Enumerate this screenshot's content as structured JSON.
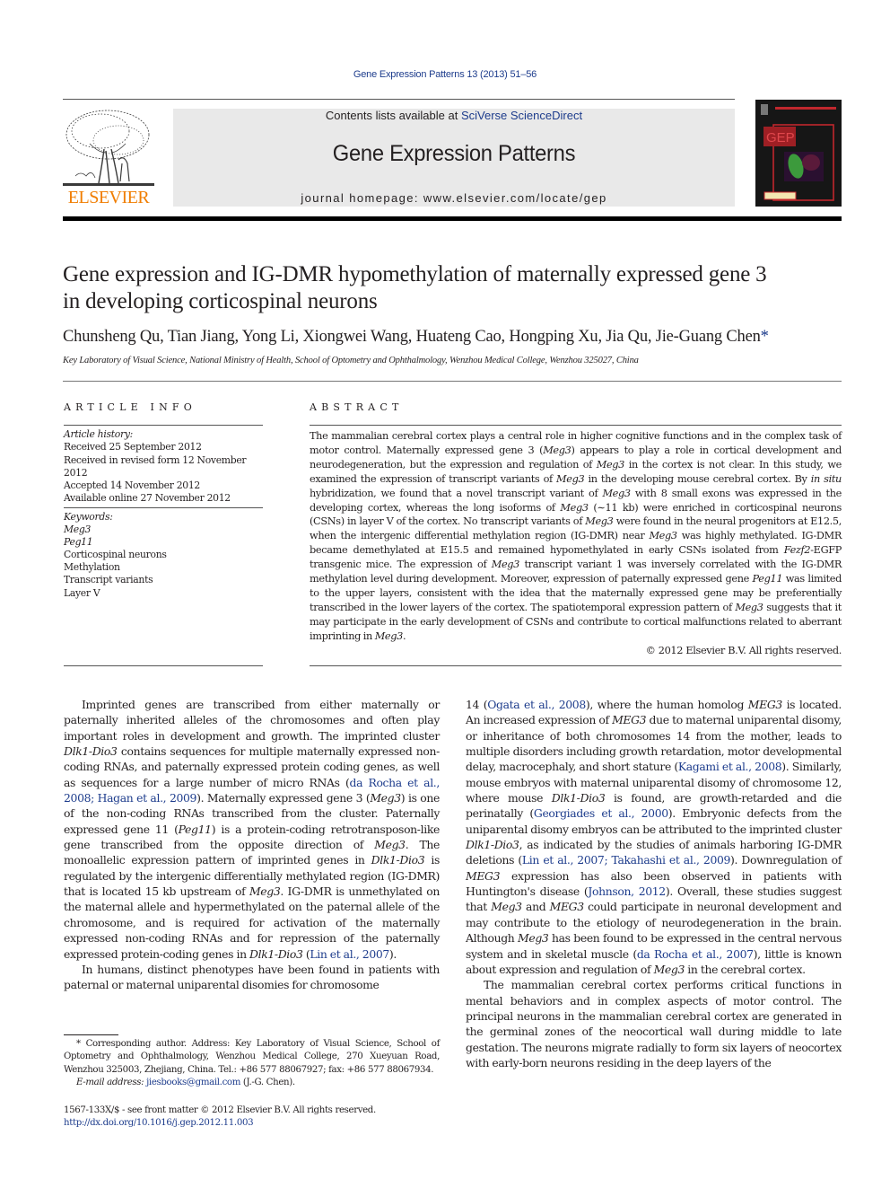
{
  "citation": "Gene Expression Patterns 13 (2013) 51–56",
  "header": {
    "publisher_logo_label": "ELSEVIER",
    "contents_prefix": "Contents lists available at ",
    "contents_link": "SciVerse ScienceDirect",
    "journal_title": "Gene Expression Patterns",
    "homepage_prefix": "journal homepage: ",
    "homepage_url": "www.elsevier.com/locate/gep",
    "cover_label": "GEP",
    "brand_colors": {
      "elsevier_orange": "#f07d00",
      "link_blue": "#1d3c8c",
      "cover_red": "#c1272d"
    }
  },
  "article": {
    "title_line1": "Gene expression and IG-DMR hypomethylation of maternally expressed gene 3",
    "title_line2": "in developing corticospinal neurons",
    "authors": "Chunsheng Qu, Tian Jiang, Yong Li, Xiongwei Wang, Huateng Cao, Hongping Xu, Jia Qu, Jie-Guang Chen",
    "corresponding_mark": "*",
    "affiliation": "Key Laboratory of Visual Science, National Ministry of Health, School of Optometry and Ophthalmology, Wenzhou Medical College, Wenzhou 325027, China"
  },
  "article_info": {
    "heading": "ARTICLE INFO",
    "history_label": "Article history:",
    "history": [
      "Received 25 September 2012",
      "Received in revised form 12 November 2012",
      "Accepted 14 November 2012",
      "Available online 27 November 2012"
    ],
    "keywords_label": "Keywords:",
    "keywords": [
      {
        "text": "Meg3",
        "italic": true
      },
      {
        "text": "Peg11",
        "italic": true
      },
      {
        "text": "Corticospinal neurons",
        "italic": false
      },
      {
        "text": "Methylation",
        "italic": false
      },
      {
        "text": "Transcript variants",
        "italic": false
      },
      {
        "text": "Layer V",
        "italic": false
      }
    ]
  },
  "abstract": {
    "heading": "ABSTRACT",
    "segments": [
      {
        "t": "The mammalian cerebral cortex plays a central role in higher cognitive functions and in the complex task of motor control. Maternally expressed gene 3 ("
      },
      {
        "t": "Meg3",
        "i": true
      },
      {
        "t": ") appears to play a role in cortical development and neurodegeneration, but the expression and regulation of "
      },
      {
        "t": "Meg3",
        "i": true
      },
      {
        "t": " in the cortex is not clear. In this study, we examined the expression of transcript variants of "
      },
      {
        "t": "Meg3",
        "i": true
      },
      {
        "t": " in the developing mouse cerebral cortex. By "
      },
      {
        "t": "in situ",
        "i": true
      },
      {
        "t": " hybridization, we found that a novel transcript variant of "
      },
      {
        "t": "Meg3",
        "i": true
      },
      {
        "t": " with 8 small exons was expressed in the developing cortex, whereas the long isoforms of "
      },
      {
        "t": "Meg3",
        "i": true
      },
      {
        "t": " (∼11 kb) were enriched in corticospinal neurons (CSNs) in layer V of the cortex. No transcript variants of "
      },
      {
        "t": "Meg3",
        "i": true
      },
      {
        "t": " were found in the neural progenitors at E12.5, when the intergenic differential methylation region (IG-DMR) near "
      },
      {
        "t": "Meg3",
        "i": true
      },
      {
        "t": " was highly methylated. IG-DMR became demethylated at E15.5 and remained hypomethylated in early CSNs isolated from "
      },
      {
        "t": "Fezf2",
        "i": true
      },
      {
        "t": "-EGFP transgenic mice. The expression of "
      },
      {
        "t": "Meg3",
        "i": true
      },
      {
        "t": " transcript variant 1 was inversely correlated with the IG-DMR methylation level during development. Moreover, expression of paternally expressed gene "
      },
      {
        "t": "Peg11",
        "i": true
      },
      {
        "t": " was limited to the upper layers, consistent with the idea that the maternally expressed gene may be pref­erentially transcribed in the lower layers of the cortex. The spatiotemporal expression pattern of "
      },
      {
        "t": "Meg3",
        "i": true
      },
      {
        "t": " suggests that it may participate in the early development of CSNs and contribute to cortical malfunctions related to aberrant imprinting in "
      },
      {
        "t": "Meg3",
        "i": true
      },
      {
        "t": "."
      }
    ],
    "copyright": "© 2012 Elsevier B.V. All rights reserved."
  },
  "body": {
    "left_column": [
      {
        "indent": true,
        "segments": [
          {
            "t": "Imprinted genes are transcribed from either maternally or paternally inherited alleles of the chromosomes and often play important roles in development and growth. The imprinted cluster "
          },
          {
            "t": "Dlk1-Dio3",
            "i": true
          },
          {
            "t": " contains sequences for multiple maternally expressed non-coding RNAs, and paternally expressed protein coding genes, as well as sequences for a large number of micro RNAs ("
          },
          {
            "t": "da Rocha et al., 2008; Hagan et al., 2009",
            "l": true
          },
          {
            "t": "). Maternally expressed gene 3 ("
          },
          {
            "t": "Meg3",
            "i": true
          },
          {
            "t": ") is one of the non-coding RNAs transcribed from the cluster. Paternally expressed gene 11 ("
          },
          {
            "t": "Peg11",
            "i": true
          },
          {
            "t": ") is a protein-coding retro­transposon-like gene transcribed from the opposite direction of "
          },
          {
            "t": "Meg3",
            "i": true
          },
          {
            "t": ". The monoallelic expression pattern of imprinted genes in "
          },
          {
            "t": "Dlk1-Dio3",
            "i": true
          },
          {
            "t": " is regulated by the intergenic differentially methylated region (IG-DMR) that is located 15 kb upstream of "
          },
          {
            "t": "Meg3",
            "i": true
          },
          {
            "t": ". IG-DMR is unmethylated on the maternal allele and hypermethylated on the paternal allele of the chromosome, and is required for activa­tion of the maternally expressed non-coding RNAs and for repres­sion of the paternally expressed protein-coding genes in "
          },
          {
            "t": "Dlk1-Dio3",
            "i": true
          },
          {
            "t": " ("
          },
          {
            "t": "Lin et al., 2007",
            "l": true
          },
          {
            "t": ")."
          }
        ]
      },
      {
        "indent": true,
        "segments": [
          {
            "t": "In humans, distinct phenotypes have been found in patients with paternal or maternal uniparental disomies for chromosome"
          }
        ]
      }
    ],
    "right_column": [
      {
        "indent": false,
        "segments": [
          {
            "t": "14 ("
          },
          {
            "t": "Ogata et al., 2008",
            "l": true
          },
          {
            "t": "), where the human homolog "
          },
          {
            "t": "MEG3",
            "i": true
          },
          {
            "t": " is located. An increased expression of "
          },
          {
            "t": "MEG3",
            "i": true
          },
          {
            "t": " due to maternal uniparental dis­omy, or inheritance of both chromosomes 14 from the mother, leads to multiple disorders including growth retardation, motor developmental delay, macrocephaly, and short stature ("
          },
          {
            "t": "Kagami et al., 2008",
            "l": true
          },
          {
            "t": "). Similarly, mouse embryos with maternal uniparental disomy of chromosome 12, where mouse "
          },
          {
            "t": "Dlk1-Dio3",
            "i": true
          },
          {
            "t": " is found, are growth-retarded and die perinatally ("
          },
          {
            "t": "Georgiades et al., 2000",
            "l": true
          },
          {
            "t": "). Embryonic defects from the uniparental disomy embryos can be attributed to the imprinted cluster "
          },
          {
            "t": "Dlk1-Dio3",
            "i": true
          },
          {
            "t": ", as indicated by the studies of animals harboring IG-DMR deletions ("
          },
          {
            "t": "Lin et al., 2007; Takahashi et al., 2009",
            "l": true
          },
          {
            "t": "). Downregulation of "
          },
          {
            "t": "MEG3",
            "i": true
          },
          {
            "t": " expression has also been observed in patients with Huntington's disease ("
          },
          {
            "t": "Johnson, 2012",
            "l": true
          },
          {
            "t": "). Overall, these studies suggest that "
          },
          {
            "t": "Meg3",
            "i": true
          },
          {
            "t": " and "
          },
          {
            "t": "MEG3",
            "i": true
          },
          {
            "t": " could participate in neuronal development and may contribute to the eti­ology of neurodegeneration in the brain. Although "
          },
          {
            "t": "Meg3",
            "i": true
          },
          {
            "t": " has been found to be expressed in the central nervous system and in skeletal muscle ("
          },
          {
            "t": "da Rocha et al., 2007",
            "l": true
          },
          {
            "t": "), little is known about expression and regulation of "
          },
          {
            "t": "Meg3",
            "i": true
          },
          {
            "t": " in the cerebral cortex."
          }
        ]
      },
      {
        "indent": true,
        "segments": [
          {
            "t": "The mammalian cerebral cortex performs critical functions in mental behaviors and in complex aspects of motor control. The principal neurons in the mammalian cerebral cortex are generated in the germinal zones of the neocortical wall during middle to late gestation. The neurons migrate radially to form six layers of neo­cortex with early-born neurons residing in the deep layers of the"
          }
        ]
      }
    ]
  },
  "footnote": {
    "corresponding": "* Corresponding author. Address: Key Laboratory of Visual Science, School of Optometry and Ophthalmology, Wenzhou Medical College, 270 Xueyuan Road, Wenzhou 325003, Zhejiang, China. Tel.: +86 577 88067927; fax: +86 577 88067934.",
    "email_label": "E-mail address:",
    "email": "jiesbooks@gmail.com",
    "email_suffix": " (J.-G. Chen)."
  },
  "front_matter": {
    "issn_line": "1567-133X/$ - see front matter © 2012 Elsevier B.V. All rights reserved.",
    "doi": "http://dx.doi.org/10.1016/j.gep.2012.11.003"
  }
}
